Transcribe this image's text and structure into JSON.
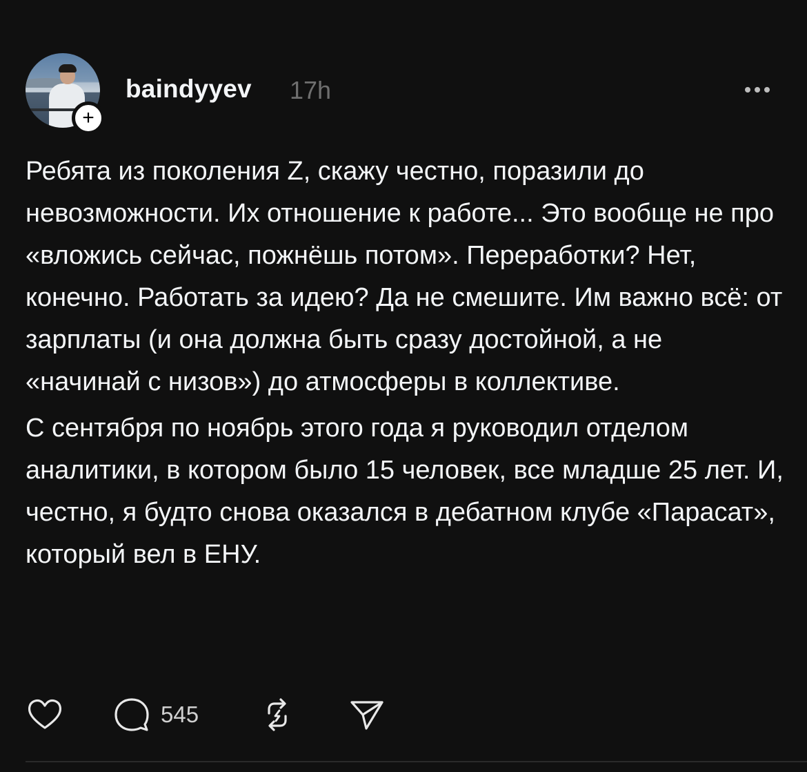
{
  "post": {
    "username": "baindyyev",
    "time_ago": "17h",
    "follow_badge": "+",
    "paragraphs": [
      "Ребята из поколения Z, скажу честно, поразили до невозможности. Их отношение к работе... Это вообще не про «вложись сейчас, пожнёшь потом». Переработки? Нет, конечно. Работать за идею? Да не смешите. Им важно всё: от зарплаты (и она должна быть сразу достойной, а не «начинай с низов») до атмосферы в коллективе.",
      "С сентября по ноябрь этого года я руководил отделом аналитики, в котором было 15 человек, все младше 25 лет. И, честно, я будто снова оказался в дебатном клубе «Парасат», который вел в ЕНУ."
    ],
    "reply_count": "545",
    "icons": {
      "more": "more-horizontal-icon",
      "like": "heart-icon",
      "reply": "comment-icon",
      "repost": "repost-icon",
      "share": "send-icon"
    }
  },
  "colors": {
    "background": "#101010",
    "text": "#f3f5f7",
    "muted": "#6f6f6f"
  }
}
